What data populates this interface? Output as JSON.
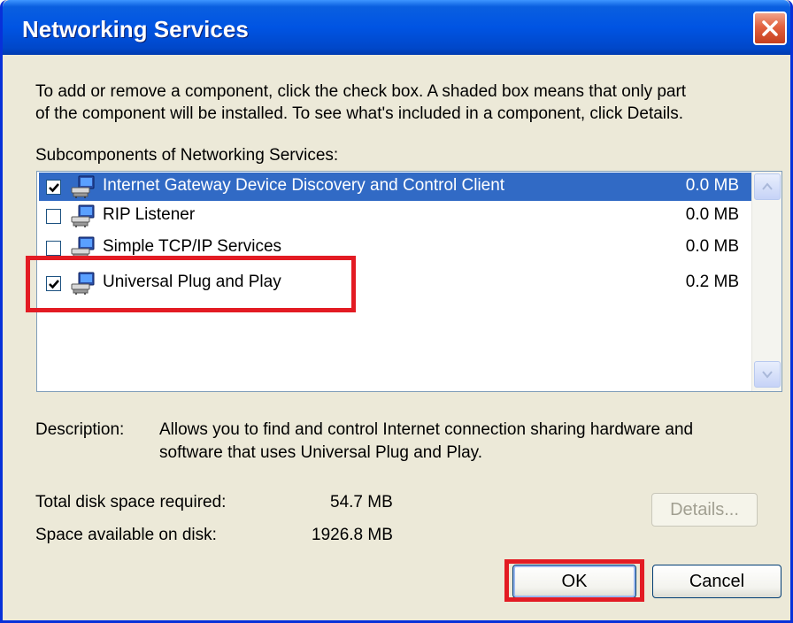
{
  "window": {
    "title": "Networking Services"
  },
  "intro": {
    "line1": "To add or remove a component, click the check box. A shaded box means that only part",
    "line2": "of the component will be installed. To see what's included in a component, click Details."
  },
  "list": {
    "label": "Subcomponents of Networking Services:",
    "items": [
      {
        "label": "Internet Gateway Device Discovery and Control Client",
        "size": "0.0 MB",
        "checked": true,
        "selected": true
      },
      {
        "label": "RIP Listener",
        "size": "0.0 MB",
        "checked": false,
        "selected": false
      },
      {
        "label": "Simple TCP/IP Services",
        "size": "0.0 MB",
        "checked": false,
        "selected": false
      },
      {
        "label": "Universal Plug and Play",
        "size": "0.2 MB",
        "checked": true,
        "selected": false
      }
    ]
  },
  "description": {
    "label": "Description:",
    "line1": "Allows you to find and control Internet connection sharing hardware and",
    "line2": "software that uses Universal Plug and Play."
  },
  "disk": {
    "required_label": "Total disk space required:",
    "required_value": "54.7 MB",
    "available_label": "Space available on disk:",
    "available_value": "1926.8 MB"
  },
  "buttons": {
    "details": "Details...",
    "ok": "OK",
    "cancel": "Cancel"
  },
  "colors": {
    "title_bar": "#0054e3",
    "selection": "#316ac5",
    "highlight": "#e31b23"
  }
}
